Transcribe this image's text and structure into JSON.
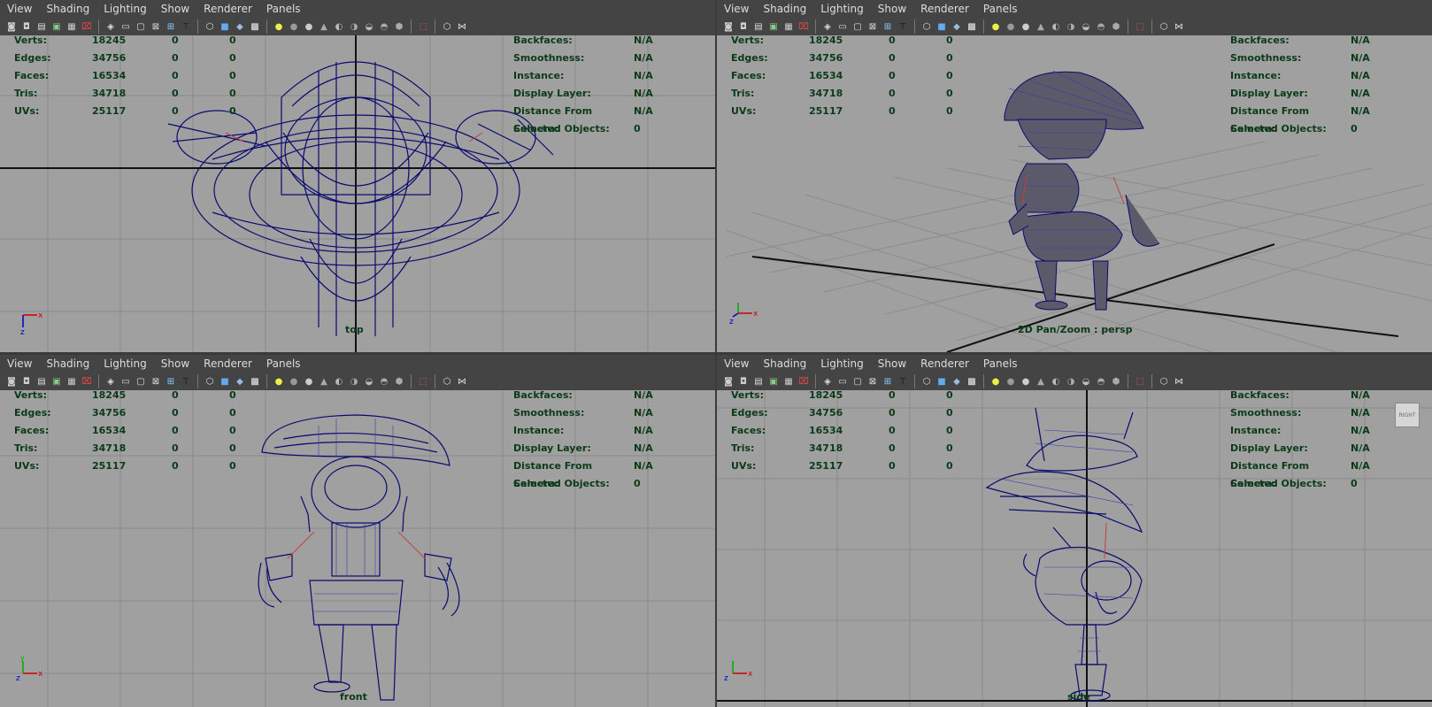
{
  "menus": [
    "View",
    "Shading",
    "Lighting",
    "Show",
    "Renderer",
    "Panels"
  ],
  "toolbar_icons": [
    "camera-icon",
    "camera-attributes-icon",
    "bookmark-icon",
    "image-plane-icon",
    "grid-toggle-icon",
    "isolate-select-icon",
    "wireframe-icon",
    "resolution-gate-icon",
    "gate-mask-icon",
    "field-chart-icon",
    "safe-action-icon",
    "safe-title-icon",
    "wireframe-shading-icon",
    "smooth-shade-icon",
    "flat-shade-icon",
    "textured-icon",
    "use-default-light-icon",
    "shadows-icon",
    "screen-space-ao-icon",
    "motion-blur-icon",
    "multisample-aa-icon",
    "depth-of-field-icon",
    "xray-icon",
    "xray-joints-icon",
    "xray-components-icon",
    "isolate-icon",
    "camera-cube-icon",
    "share-icon"
  ],
  "hud_left": {
    "rows": [
      {
        "label": "Verts:",
        "v1": "18245",
        "v2": "0",
        "v3": "0"
      },
      {
        "label": "Edges:",
        "v1": "34756",
        "v2": "0",
        "v3": "0"
      },
      {
        "label": "Faces:",
        "v1": "16534",
        "v2": "0",
        "v3": "0"
      },
      {
        "label": "Tris:",
        "v1": "34718",
        "v2": "0",
        "v3": "0"
      },
      {
        "label": "UVs:",
        "v1": "25117",
        "v2": "0",
        "v3": "0"
      }
    ]
  },
  "hud_right": {
    "rows": [
      {
        "label": "Backfaces:",
        "val": "N/A"
      },
      {
        "label": "Smoothness:",
        "val": "N/A"
      },
      {
        "label": "Instance:",
        "val": "N/A"
      },
      {
        "label": "Display Layer:",
        "val": "N/A"
      },
      {
        "label": "Distance From Camera:",
        "val": "N/A"
      },
      {
        "label": "Selected Objects:",
        "val": "0"
      }
    ]
  },
  "viewports": {
    "top": {
      "label": "top"
    },
    "persp": {
      "label": "2D Pan/Zoom : persp"
    },
    "front": {
      "label": "front"
    },
    "side": {
      "label": "side",
      "view_cube": "RIGHT"
    }
  },
  "colors": {
    "viewport_bg": "#a0a0a0",
    "wire": "#0a0a6e",
    "hud_text": "#0b3a18"
  }
}
